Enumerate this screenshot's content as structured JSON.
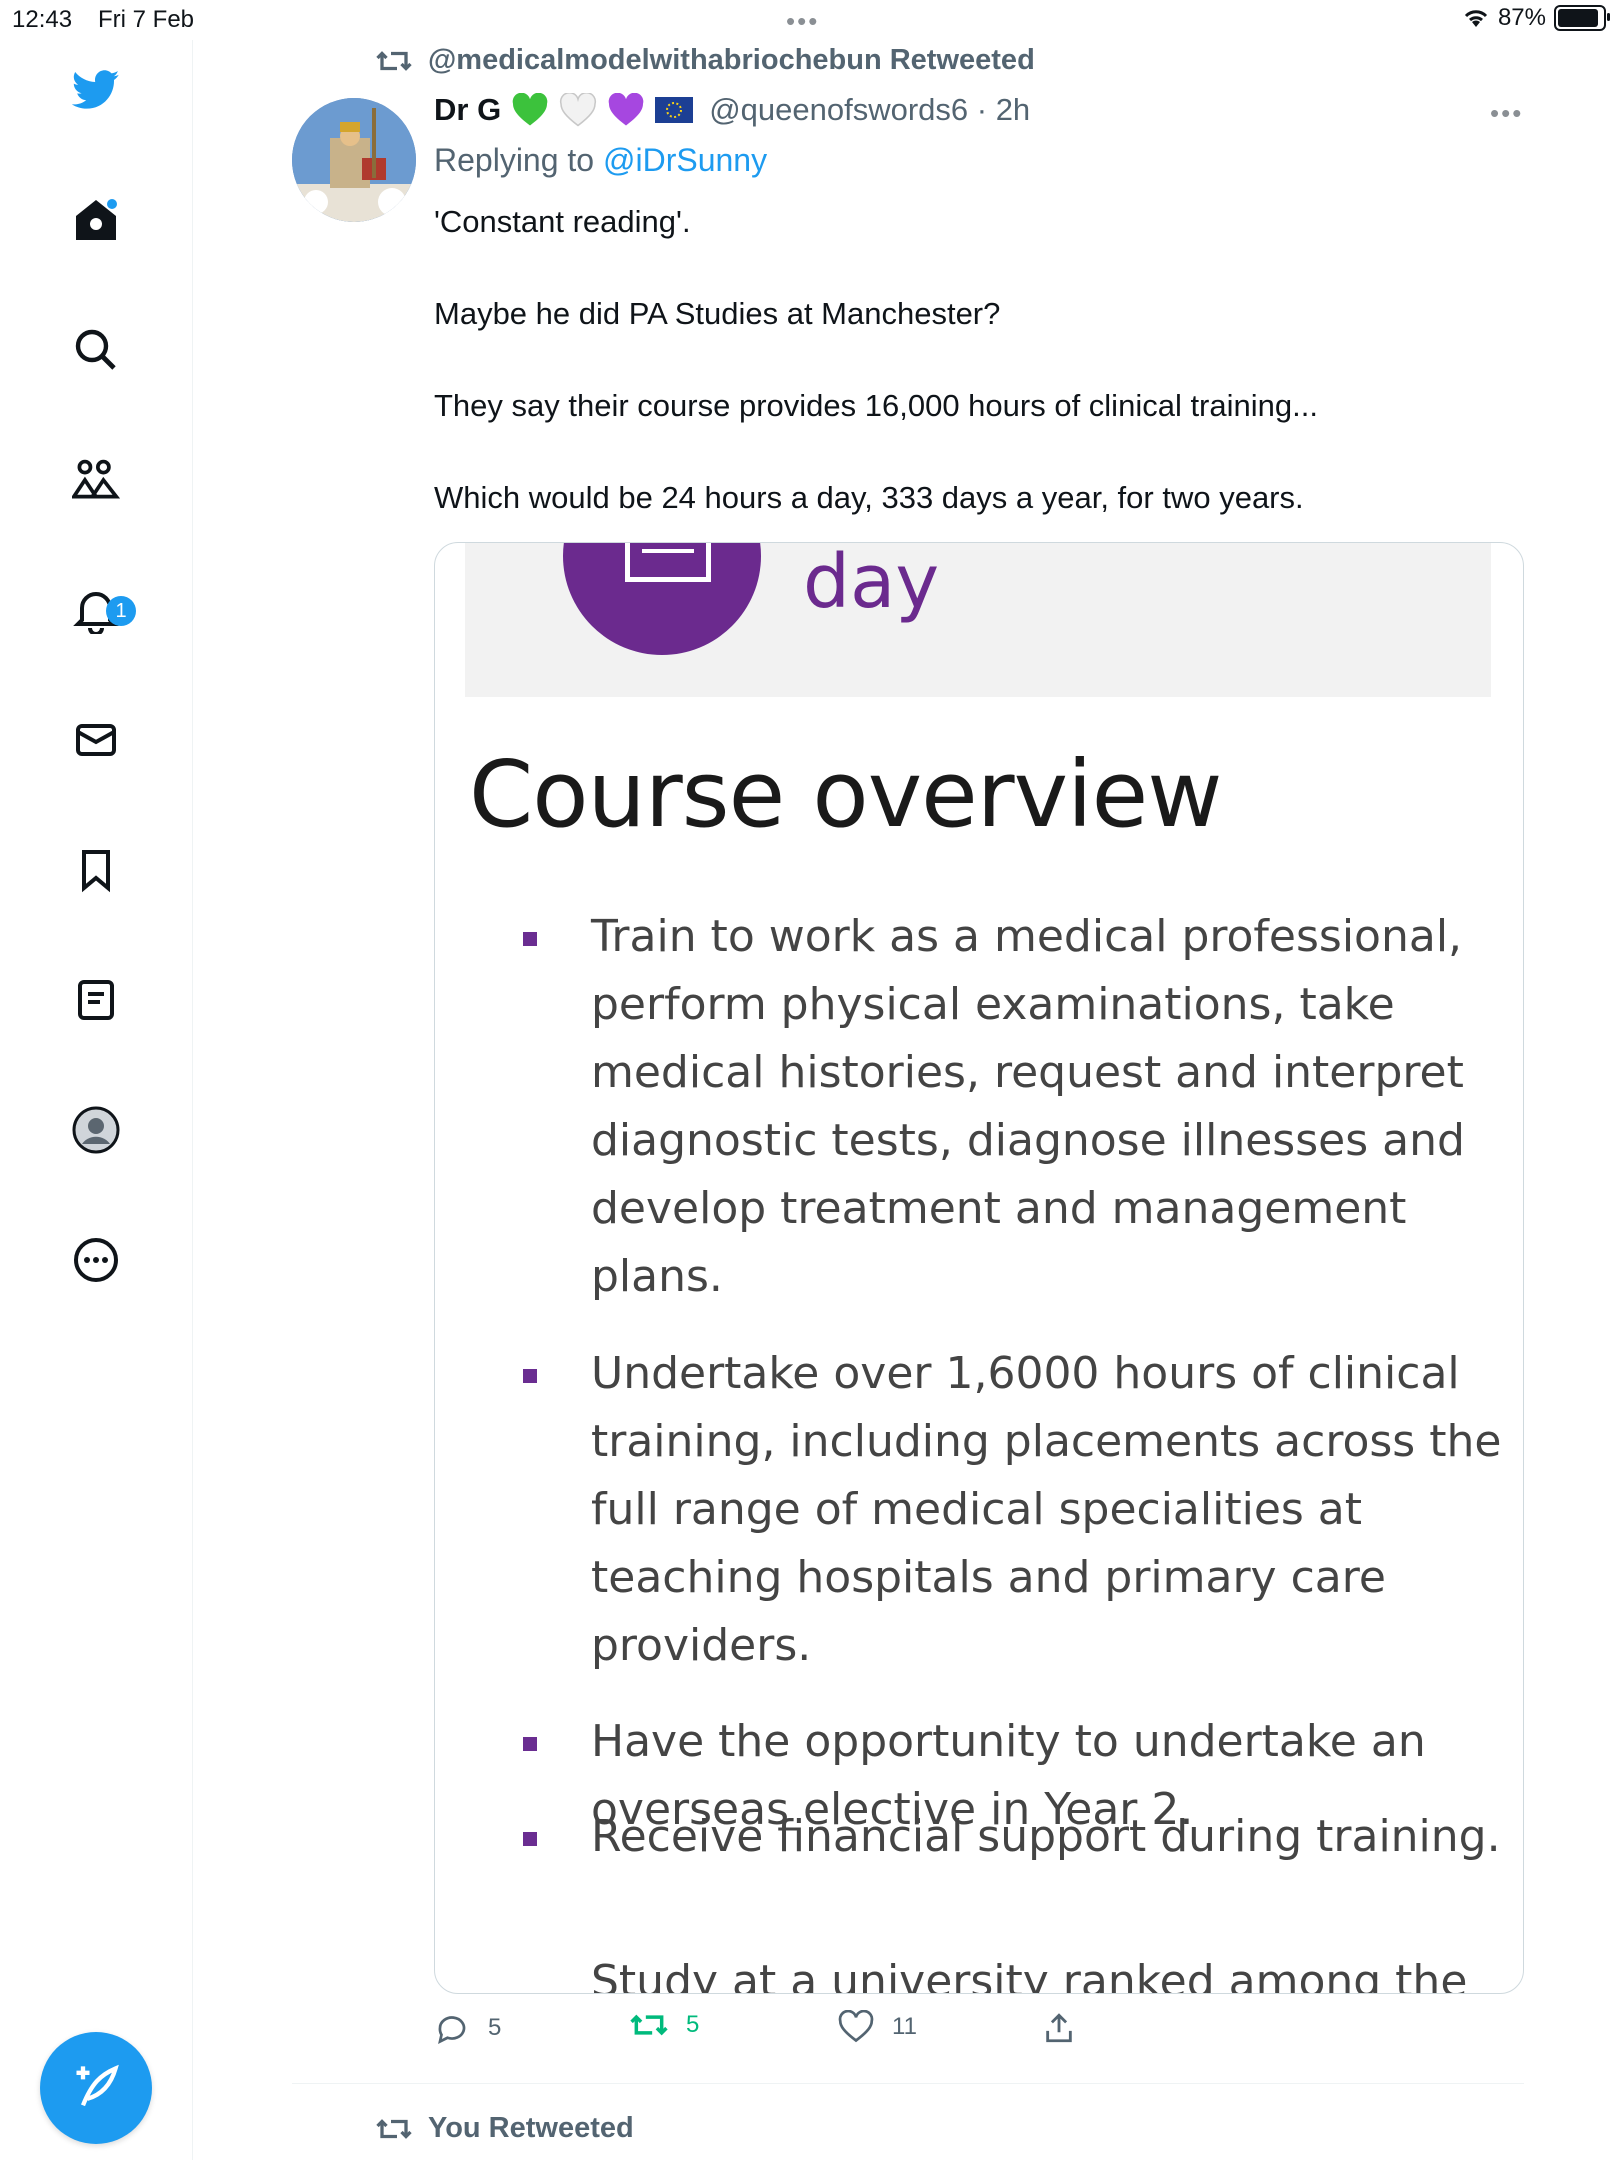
{
  "status_bar": {
    "time": "12:43",
    "date": "Fri 7 Feb",
    "battery": "87%"
  },
  "sidebar": {
    "items": [
      {
        "icon": "twitter-bird-icon"
      },
      {
        "icon": "home-icon"
      },
      {
        "icon": "search-icon"
      },
      {
        "icon": "communities-icon"
      },
      {
        "icon": "notifications-icon",
        "badge": "1"
      },
      {
        "icon": "messages-icon"
      },
      {
        "icon": "bookmark-icon"
      },
      {
        "icon": "lists-icon"
      },
      {
        "icon": "profile-icon"
      },
      {
        "icon": "more-icon"
      }
    ],
    "compose_icon": "compose-icon"
  },
  "tweet": {
    "retweeted_by": "@medicalmodelwithabriochebun Retweeted",
    "author_name": "Dr G",
    "handle_time": "@queenofswords6 · 2h",
    "replying_prefix": "Replying to ",
    "replying_to": "@iDrSunny",
    "paragraphs": [
      "'Constant reading'.",
      "Maybe he did PA Studies at Manchester?",
      "They say their course provides 16,000 hours of clinical training...",
      "Which would be 24 hours a day, 333 days a year, for two years."
    ],
    "media": {
      "banner_text": "day",
      "heading": "Course overview",
      "bullets": [
        "Train to work as a medical professional,\nperform physical examinations, take\nmedical histories, request and interpret\ndiagnostic tests, diagnose illnesses and\ndevelop treatment and management\nplans.",
        "Undertake over 1,6000 hours of clinical\ntraining, including placements across the\nfull range of medical specialities at\nteaching hospitals and primary care\nproviders.",
        "Have the opportunity to undertake an\noverseas elective in Year 2.",
        "Receive financial support during training."
      ],
      "cut_off_text": "Study at a university ranked among the"
    },
    "actions": {
      "replies": "5",
      "retweets": "5",
      "likes": "11"
    }
  },
  "next_tweet": {
    "retweet_label": "You Retweeted"
  },
  "colors": {
    "accent": "#1d9bf0",
    "retweet_green": "#00ba7c",
    "purple": "#6b2a8e"
  }
}
